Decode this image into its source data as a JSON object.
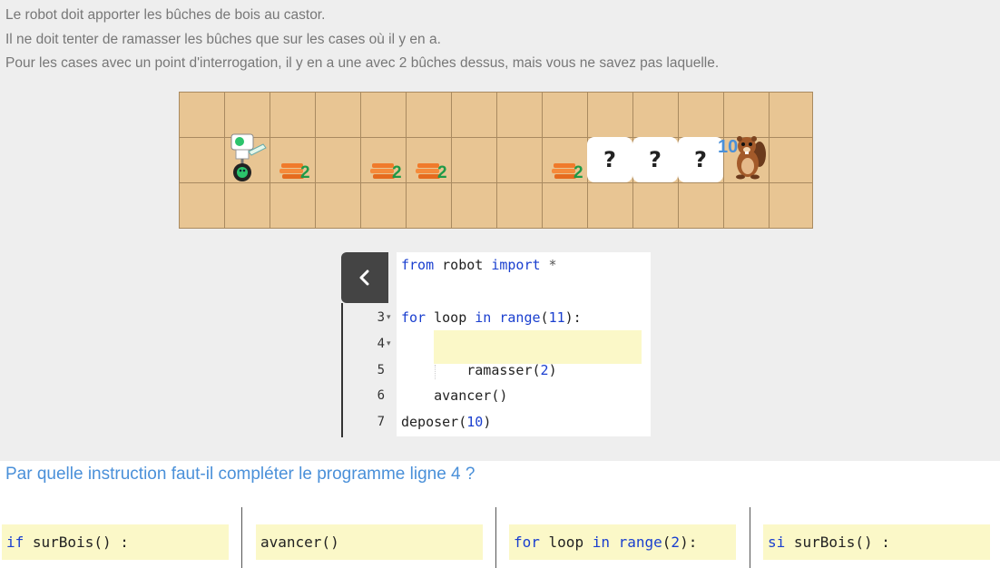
{
  "instructions": [
    "Le robot doit apporter les bûches de bois au castor.",
    "Il ne doit tenter de ramasser les bûches que sur les cases où il y en a.",
    "Pour les cases avec un point d'interrogation, il y en a une avec 2 bûches dessus, mais vous ne savez pas laquelle."
  ],
  "grid": {
    "rows": 3,
    "cols": 14,
    "log_counts": [
      "2",
      "2",
      "2",
      "2"
    ],
    "question_marks": [
      "?",
      "?",
      "?"
    ],
    "beaver_need": "10"
  },
  "editor": {
    "back_icon": "chevron-left-icon",
    "lines": [
      {
        "num": "",
        "tokens": [
          [
            "kw",
            "from"
          ],
          [
            "txt",
            " robot "
          ],
          [
            "kw",
            "import"
          ],
          [
            "op",
            " *"
          ]
        ]
      },
      {
        "num": "",
        "tokens": []
      },
      {
        "num": "3",
        "fold": true,
        "tokens": [
          [
            "kw",
            "for"
          ],
          [
            "txt",
            " loop "
          ],
          [
            "kw",
            "in"
          ],
          [
            "txt",
            " "
          ],
          [
            "kw",
            "range"
          ],
          [
            "txt",
            "("
          ],
          [
            "num",
            "11"
          ],
          [
            "txt",
            "):"
          ]
        ]
      },
      {
        "num": "4",
        "fold": true,
        "tokens": []
      },
      {
        "num": "5",
        "tokens": [
          [
            "txt",
            "        ramasser("
          ],
          [
            "num",
            "2"
          ],
          [
            "txt",
            ")"
          ]
        ]
      },
      {
        "num": "6",
        "tokens": [
          [
            "txt",
            "    avancer()"
          ]
        ]
      },
      {
        "num": "7",
        "tokens": [
          [
            "txt",
            "deposer("
          ],
          [
            "num",
            "10"
          ],
          [
            "txt",
            ")"
          ]
        ]
      }
    ]
  },
  "question": "Par quelle instruction faut-il compléter le programme ligne 4 ?",
  "answers": [
    [
      [
        "kw",
        "if"
      ],
      [
        "txt",
        " surBois() :"
      ]
    ],
    [
      [
        "txt",
        "avancer()"
      ]
    ],
    [
      [
        "kw",
        "for"
      ],
      [
        "txt",
        " loop "
      ],
      [
        "kw",
        "in"
      ],
      [
        "txt",
        " "
      ],
      [
        "kw",
        "range"
      ],
      [
        "txt",
        "("
      ],
      [
        "num",
        "2"
      ],
      [
        "txt",
        "):"
      ]
    ],
    [
      [
        "kw",
        "si"
      ],
      [
        "txt",
        " surBois() :"
      ]
    ]
  ],
  "colors": {
    "grid_bg": "#e8c593",
    "question": "#4a90d9",
    "highlight": "#fbf8c8",
    "keyword": "#1a3fcf"
  }
}
